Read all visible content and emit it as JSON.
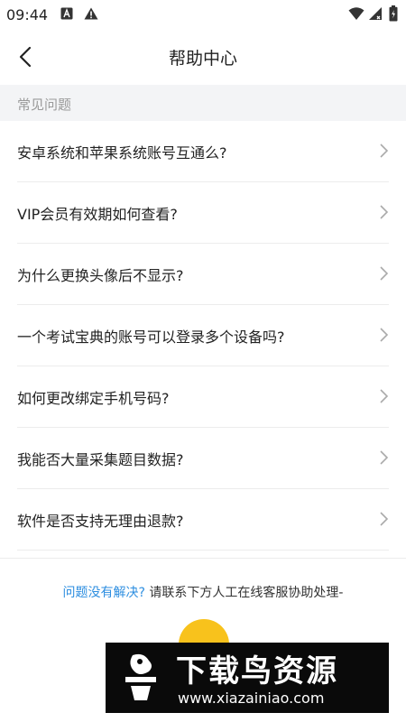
{
  "status_bar": {
    "time": "09:44",
    "icons": [
      "notification-a-icon",
      "warning-icon",
      "wifi-icon",
      "signal-icon",
      "battery-icon"
    ]
  },
  "header": {
    "title": "帮助中心",
    "back_icon": "chevron-left-icon"
  },
  "section": {
    "title": "常见问题"
  },
  "faq": [
    {
      "question": "安卓系统和苹果系统账号互通么?"
    },
    {
      "question": "VIP会员有效期如何查看?"
    },
    {
      "question": "为什么更换头像后不显示?"
    },
    {
      "question": "一个考试宝典的账号可以登录多个设备吗?"
    },
    {
      "question": "如何更改绑定手机号码?"
    },
    {
      "question": "我能否大量采集题目数据?"
    },
    {
      "question": "软件是否支持无理由退款?"
    }
  ],
  "footer": {
    "link_text": "问题没有解决?",
    "contact_text": "请联系下方人工在线客服协助处理-"
  },
  "watermark": {
    "title": "下载鸟资源",
    "url": "www.xiazainiao.com"
  },
  "colors": {
    "accent": "#2d8ee0",
    "section_bg": "#f3f4f6",
    "fab": "#f8c21c"
  }
}
